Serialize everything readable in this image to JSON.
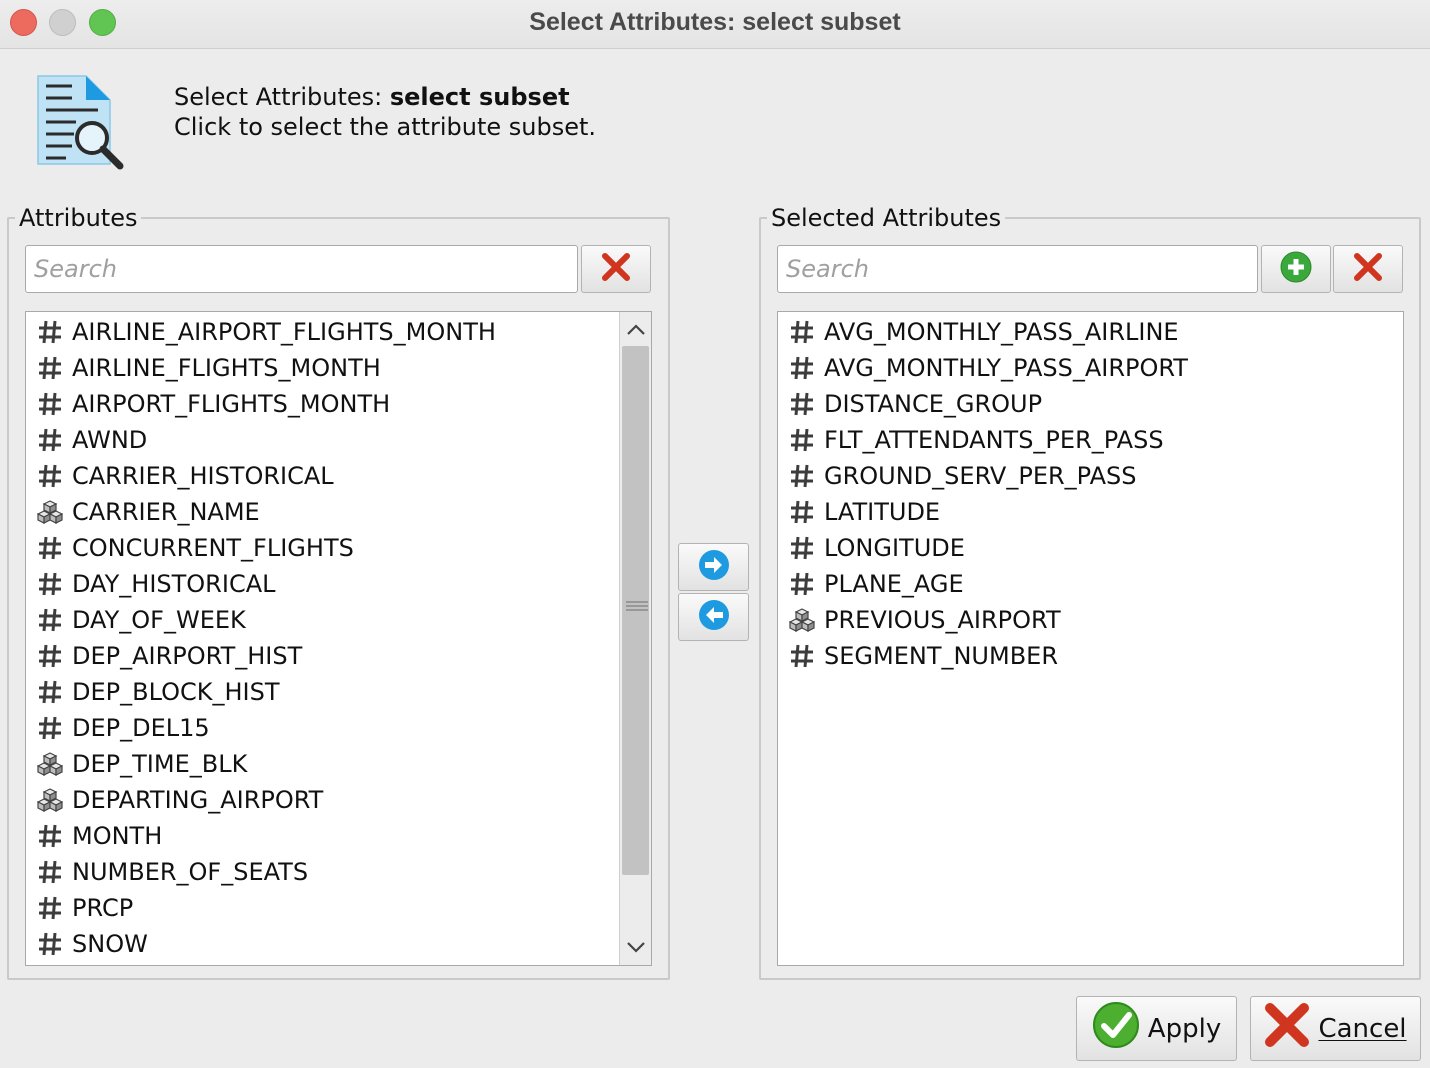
{
  "window": {
    "title": "Select Attributes: select subset"
  },
  "header": {
    "title_prefix": "Select Attributes: ",
    "title_bold": "select subset",
    "description": "Click to select the attribute subset.",
    "icon": "document-search-icon"
  },
  "attributes_panel": {
    "legend": "Attributes",
    "search_placeholder": "Search",
    "items": [
      {
        "name": "AIRLINE_AIRPORT_FLIGHTS_MONTH",
        "type": "numeric"
      },
      {
        "name": "AIRLINE_FLIGHTS_MONTH",
        "type": "numeric"
      },
      {
        "name": "AIRPORT_FLIGHTS_MONTH",
        "type": "numeric"
      },
      {
        "name": "AWND",
        "type": "numeric"
      },
      {
        "name": "CARRIER_HISTORICAL",
        "type": "numeric"
      },
      {
        "name": "CARRIER_NAME",
        "type": "nominal"
      },
      {
        "name": "CONCURRENT_FLIGHTS",
        "type": "numeric"
      },
      {
        "name": "DAY_HISTORICAL",
        "type": "numeric"
      },
      {
        "name": "DAY_OF_WEEK",
        "type": "numeric"
      },
      {
        "name": "DEP_AIRPORT_HIST",
        "type": "numeric"
      },
      {
        "name": "DEP_BLOCK_HIST",
        "type": "numeric"
      },
      {
        "name": "DEP_DEL15",
        "type": "numeric"
      },
      {
        "name": "DEP_TIME_BLK",
        "type": "nominal"
      },
      {
        "name": "DEPARTING_AIRPORT",
        "type": "nominal"
      },
      {
        "name": "MONTH",
        "type": "numeric"
      },
      {
        "name": "NUMBER_OF_SEATS",
        "type": "numeric"
      },
      {
        "name": "PRCP",
        "type": "numeric"
      },
      {
        "name": "SNOW",
        "type": "numeric"
      }
    ]
  },
  "selected_panel": {
    "legend": "Selected Attributes",
    "search_placeholder": "Search",
    "items": [
      {
        "name": "AVG_MONTHLY_PASS_AIRLINE",
        "type": "numeric"
      },
      {
        "name": "AVG_MONTHLY_PASS_AIRPORT",
        "type": "numeric"
      },
      {
        "name": "DISTANCE_GROUP",
        "type": "numeric"
      },
      {
        "name": "FLT_ATTENDANTS_PER_PASS",
        "type": "numeric"
      },
      {
        "name": "GROUND_SERV_PER_PASS",
        "type": "numeric"
      },
      {
        "name": "LATITUDE",
        "type": "numeric"
      },
      {
        "name": "LONGITUDE",
        "type": "numeric"
      },
      {
        "name": "PLANE_AGE",
        "type": "numeric"
      },
      {
        "name": "PREVIOUS_AIRPORT",
        "type": "nominal"
      },
      {
        "name": "SEGMENT_NUMBER",
        "type": "numeric"
      }
    ]
  },
  "icons": {
    "numeric": "hash-icon",
    "nominal": "cubes-icon"
  },
  "buttons": {
    "apply_label": "Apply",
    "cancel_label": "Cancel"
  },
  "colors": {
    "clear_red": "#d0351f",
    "add_green": "#3aa83a",
    "arrow_blue": "#1e9be0",
    "apply_green": "#4caf30"
  }
}
